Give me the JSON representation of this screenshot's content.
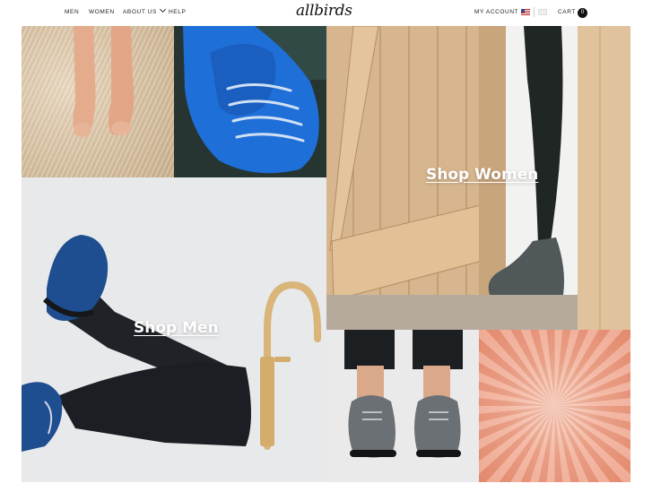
{
  "header": {
    "nav": [
      {
        "label": "MEN"
      },
      {
        "label": "WOMEN"
      },
      {
        "label": "ABOUT US"
      },
      {
        "label": "HELP"
      }
    ],
    "logo": "allbirds",
    "account": "MY ACCOUNT",
    "cart": "CART",
    "cart_count": "0"
  },
  "hero": {
    "shop_women": "Shop Women",
    "shop_men": "Shop Men"
  },
  "colors": {
    "accent_blue": "#1e6fd9",
    "wood": "#d6b48c",
    "pink_fur": "#f0a48a"
  }
}
